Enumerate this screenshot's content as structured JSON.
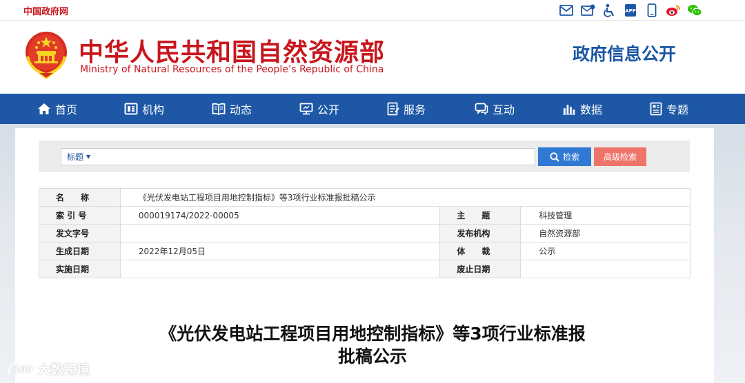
{
  "topbar": {
    "gov_link": "中国政府网",
    "icons": [
      "mail-icon",
      "email-send-icon",
      "accessibility-icon",
      "app-icon",
      "mobile-icon",
      "weibo-icon",
      "wechat-icon"
    ]
  },
  "header": {
    "title_cn": "中华人民共和国自然资源部",
    "title_en": "Ministry of Natural Resources of the People’s Republic of China",
    "section": "政府信息公开"
  },
  "nav": {
    "items": [
      {
        "label": "首页",
        "icon": "home-icon"
      },
      {
        "label": "机构",
        "icon": "org-icon"
      },
      {
        "label": "动态",
        "icon": "book-icon"
      },
      {
        "label": "公开",
        "icon": "monitor-icon"
      },
      {
        "label": "服务",
        "icon": "document-icon"
      },
      {
        "label": "互动",
        "icon": "chat-icon"
      },
      {
        "label": "数据",
        "icon": "chart-icon"
      },
      {
        "label": "专题",
        "icon": "file-icon"
      }
    ]
  },
  "search": {
    "field_select": "标题",
    "placeholder": "",
    "search_label": "检索",
    "advanced_label": "高级检索"
  },
  "info": {
    "name_label": "名　　称",
    "name_value": "《光伏发电站工程项目用地控制指标》等3项行业标准报批稿公示",
    "index_label": "索 引 号",
    "index_value": "000019174/2022-00005",
    "topic_label": "主　　题",
    "topic_value": "科技管理",
    "docno_label": "发文字号",
    "docno_value": "",
    "issuer_label": "发布机构",
    "issuer_value": "自然资源部",
    "gen_date_label": "生成日期",
    "gen_date_value": "2022年12月05日",
    "genre_label": "体　　裁",
    "genre_value": "公示",
    "impl_date_label": "实施日期",
    "impl_date_value": "",
    "expiry_label": "废止日期",
    "expiry_value": ""
  },
  "article": {
    "title_line1": "《光伏发电站工程项目用地控制指标》等3项行业标准报",
    "title_line2": "批稿公示"
  },
  "watermark": {
    "text": "大数跨境"
  },
  "colors": {
    "brand_red": "#c8161d",
    "nav_blue": "#1d57a5",
    "search_blue": "#2f79d3",
    "advanced_red": "#ee7469"
  }
}
